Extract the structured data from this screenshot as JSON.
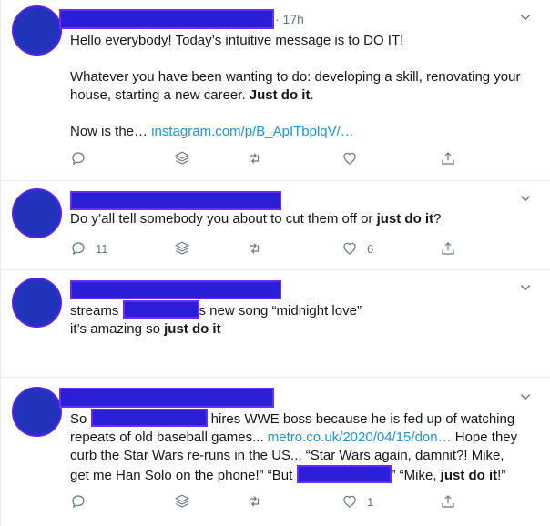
{
  "tweets": [
    {
      "time": "· 17h",
      "line1": "Hello everybody! Today’s intuitive message is to DO IT!",
      "para2_a": "Whatever you have been wanting to do: developing a skill, renovating your house, starting a new career. ",
      "para2_bold": "Just do it",
      "para2_end": ".",
      "para3_a": "Now is the… ",
      "para3_link": "instagram.com/p/B_ApITbplqV/…",
      "reply_count": "",
      "like_count": ""
    },
    {
      "text_a": "Do y’all tell somebody you about to cut them off or ",
      "text_bold": "just do it",
      "text_end": "?",
      "reply_count": "11",
      "like_count": "6"
    },
    {
      "line1_a": "streams ",
      "line1_b": "s new song “midnight love”",
      "line2_a": "it’s amazing so ",
      "line2_bold": "just do it",
      "reply_count": "",
      "like_count": ""
    },
    {
      "l1_a": "So ",
      "l1_b": " hires WWE boss because he is fed up of watching",
      "l2_a": "repeats of old baseball games... ",
      "l2_link": "metro.co.uk/2020/04/15/don…",
      "l2_b": " Hope they",
      "l3": "curb the Star Wars re-runs in the US... “Star Wars again, damnit?! Mike,",
      "l4_a": "get me Han Solo on the phone!” “But ",
      "l4_b": "” “Mike, ",
      "l4_bold": "just do it",
      "l4_end": "!”",
      "reply_count": "",
      "like_count": "1"
    }
  ],
  "icons": {
    "reply": "reply-icon",
    "stack": "stack-icon",
    "retweet": "retweet-icon",
    "like": "heart-icon",
    "share": "share-icon",
    "more": "chevron-down-icon"
  },
  "colors": {
    "link": "#1b95e0",
    "muted": "#657786",
    "redaction": "#2a1fd6"
  }
}
